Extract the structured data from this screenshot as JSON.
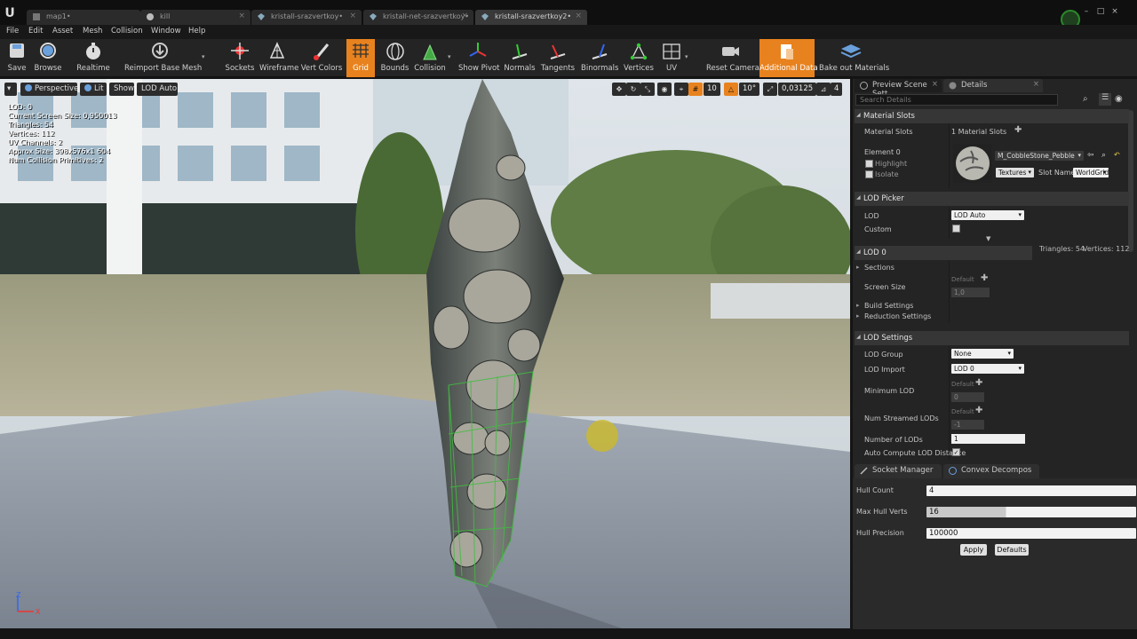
{
  "titlebar": {
    "tabs": [
      {
        "label": "map1",
        "modified": "•"
      },
      {
        "label": "kill",
        "modified": ""
      },
      {
        "label": "kristall-srazvertkoy",
        "modified": "•"
      },
      {
        "label": "kristall-net-srazvertkoy",
        "modified": "•"
      },
      {
        "label": "kristall-srazvertkoy2",
        "modified": "•"
      }
    ],
    "close_glyph": "×",
    "window_controls": [
      "–",
      "□",
      "×"
    ]
  },
  "menu": [
    "File",
    "Edit",
    "Asset",
    "Mesh",
    "Collision",
    "Window",
    "Help"
  ],
  "toolbar": {
    "save": "Save",
    "browse": "Browse",
    "realtime": "Realtime",
    "reimport": "Reimport Base Mesh",
    "sockets": "Sockets",
    "wireframe": "Wireframe",
    "vert_colors": "Vert Colors",
    "grid": "Grid",
    "bounds": "Bounds",
    "collision": "Collision",
    "show_pivot": "Show Pivot",
    "normals": "Normals",
    "tangents": "Tangents",
    "binormals": "Binormals",
    "vertices": "Vertices",
    "uv": "UV",
    "reset_camera": "Reset Camera",
    "additional_data": "Additional Data",
    "bake_out": "Bake out Materials"
  },
  "viewport": {
    "perspective": "Perspective",
    "lit": "Lit",
    "show": "Show",
    "lod_auto": "LOD Auto",
    "grid_snap": "10",
    "rot_snap": "10°",
    "scale_snap": "0,03125",
    "cam_speed": "4",
    "stats": [
      "LOD:  0",
      "Current Screen Size:  0,950013",
      "Triangles:  54",
      "Vertices:  112",
      "UV Channels:  2",
      "Approx Size: 398x576x1 604",
      "Num Collision Primitives:  2"
    ],
    "axis": {
      "z": "Z",
      "x": "X"
    }
  },
  "panel": {
    "tabs": {
      "preview": "Preview Scene Sett",
      "details": "Details"
    },
    "search_placeholder": "Search Details",
    "material_slots": {
      "header": "Material Slots",
      "label": "Material Slots",
      "value": "1 Material Slots",
      "element": "Element 0",
      "highlight": "Highlight",
      "isolate": "Isolate",
      "material_name": "M_CobbleStone_Pebble",
      "textures": "Textures",
      "slot_name_label": "Slot Name",
      "slot_name_value": "WorldGridf"
    },
    "lod_picker": {
      "header": "LOD Picker",
      "lod_label": "LOD",
      "lod_value": "LOD Auto",
      "custom": "Custom",
      "triangles": "Triangles: 54",
      "vertices": "Vertices: 112"
    },
    "lod0": {
      "header": "LOD 0",
      "sections": "Sections",
      "screen_size": "Screen Size",
      "default": "Default",
      "screen_size_value": "1,0",
      "build": "Build Settings",
      "reduction": "Reduction Settings"
    },
    "lod_settings": {
      "header": "LOD Settings",
      "group_label": "LOD Group",
      "group_value": "None",
      "import_label": "LOD Import",
      "import_value": "LOD 0",
      "min_lod": "Minimum LOD",
      "default": "Default",
      "min_lod_value": "0",
      "num_streamed": "Num Streamed LODs",
      "num_streamed_value": "-1",
      "num_lods": "Number of LODs",
      "num_lods_value": "1",
      "auto_compute": "Auto Compute LOD Distance"
    },
    "bottom_tabs": {
      "socket": "Socket Manager",
      "convex": "Convex Decompos"
    },
    "convex": {
      "hull_count_label": "Hull Count",
      "hull_count": "4",
      "max_verts_label": "Max Hull Verts",
      "max_verts": "16",
      "precision_label": "Hull Precision",
      "precision": "100000",
      "apply": "Apply",
      "defaults": "Defaults"
    }
  }
}
